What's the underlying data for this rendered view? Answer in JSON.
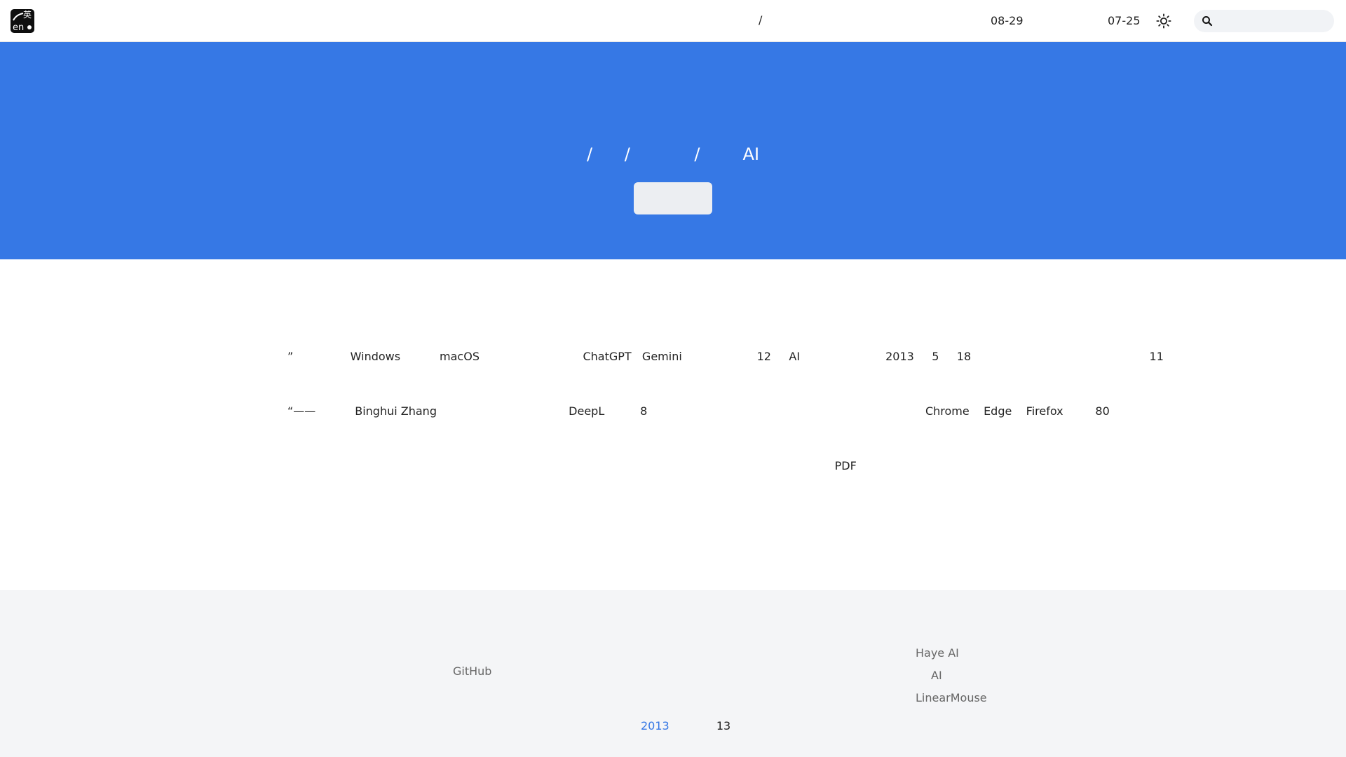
{
  "header": {
    "logo": {
      "zh": "英",
      "en": "en"
    },
    "nav_sep": "/",
    "date_a": "08-29",
    "date_b": "07-25",
    "search": {
      "placeholder": ""
    }
  },
  "hero": {
    "title": "/      /            /        AI",
    "button_label": ""
  },
  "content": {
    "lines": [
      "”                Windows           macOS                             ChatGPT   Gemini                     12     AI                        2013     5     18                                                  11",
      "“——           Binghui Zhang                                     DeepL          8                                                                              Chrome    Edge    Firefox         80",
      "                                                                                       PDF"
    ]
  },
  "footer": {
    "github": "GitHub",
    "links": [
      "Haye AI",
      "AI",
      "LinearMouse"
    ],
    "copyright_year": "2013",
    "copyright_num": "13"
  },
  "colors": {
    "accent": "#3678e5",
    "footer_bg": "#f4f5f7",
    "hero_button": "#eceef2"
  }
}
